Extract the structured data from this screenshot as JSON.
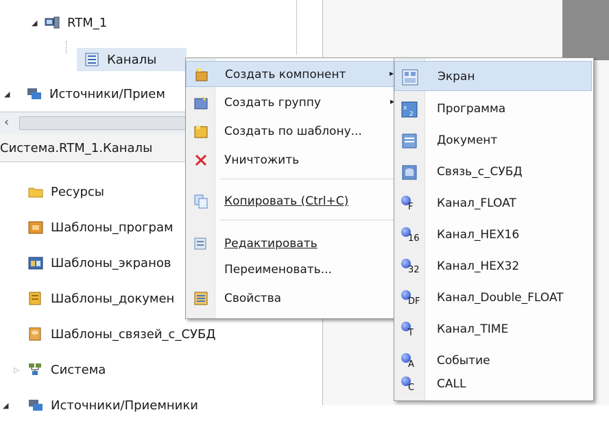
{
  "tree_top": {
    "rtm_label": "RTM_1",
    "channels_label": "Каналы",
    "sources_label": "Источники/Прием"
  },
  "breadcrumb": "Система.RTM_1.Каналы",
  "tree_bottom": {
    "items": [
      {
        "label": "Ресурсы",
        "icon": "folder-icon"
      },
      {
        "label": "Шаблоны_програм",
        "icon": "program-templates-icon"
      },
      {
        "label": "Шаблоны_экранов",
        "icon": "screen-templates-icon"
      },
      {
        "label": "Шаблоны_докумен",
        "icon": "document-templates-icon"
      },
      {
        "label": "Шаблоны_связей_с_СУБД",
        "icon": "db-templates-icon"
      },
      {
        "label": "Система",
        "icon": "system-icon"
      },
      {
        "label": "Источники/Приемники",
        "icon": "sources-icon"
      }
    ]
  },
  "context_menu": {
    "items": [
      {
        "label": "Создать компонент",
        "icon": "create-component-icon",
        "submenu": "▸"
      },
      {
        "label": "Создать группу",
        "icon": "create-group-icon",
        "submenu": "▸"
      },
      {
        "label": "Создать по шаблону...",
        "icon": "create-from-template-icon"
      },
      {
        "label": "Уничтожить",
        "icon": "delete-icon"
      },
      {
        "label": "Копировать (Ctrl+C)",
        "icon": "copy-icon"
      },
      {
        "label": "Редактировать",
        "icon": "edit-icon"
      },
      {
        "label": "Переименовать...",
        "icon": ""
      },
      {
        "label": "Свойства",
        "icon": "properties-icon"
      }
    ]
  },
  "submenu": {
    "items": [
      {
        "label": "Экран",
        "icon": "screen-icon"
      },
      {
        "label": "Программа",
        "icon": "program-icon"
      },
      {
        "label": "Документ",
        "icon": "document-icon"
      },
      {
        "label": "Связь_с_СУБД",
        "icon": "database-icon"
      },
      {
        "label": "Канал_FLOAT",
        "icon": "channel-float-icon",
        "tag": "F"
      },
      {
        "label": "Канал_HEX16",
        "icon": "channel-hex16-icon",
        "tag": "16"
      },
      {
        "label": "Канал_HEX32",
        "icon": "channel-hex32-icon",
        "tag": "32"
      },
      {
        "label": "Канал_Double_FLOAT",
        "icon": "channel-double-float-icon",
        "tag": "DF"
      },
      {
        "label": "Канал_TIME",
        "icon": "channel-time-icon",
        "tag": "T"
      },
      {
        "label": "Событие",
        "icon": "event-icon",
        "tag": "A"
      },
      {
        "label": "CALL",
        "icon": "call-icon",
        "tag": "C"
      }
    ]
  },
  "colors": {
    "highlight": "#d5e4f5",
    "highlight_border": "#a9c4e6",
    "menu_bg": "#fdfdfd",
    "gutter": "#f0f0f0",
    "channel_ball": "#1c3fc2"
  }
}
